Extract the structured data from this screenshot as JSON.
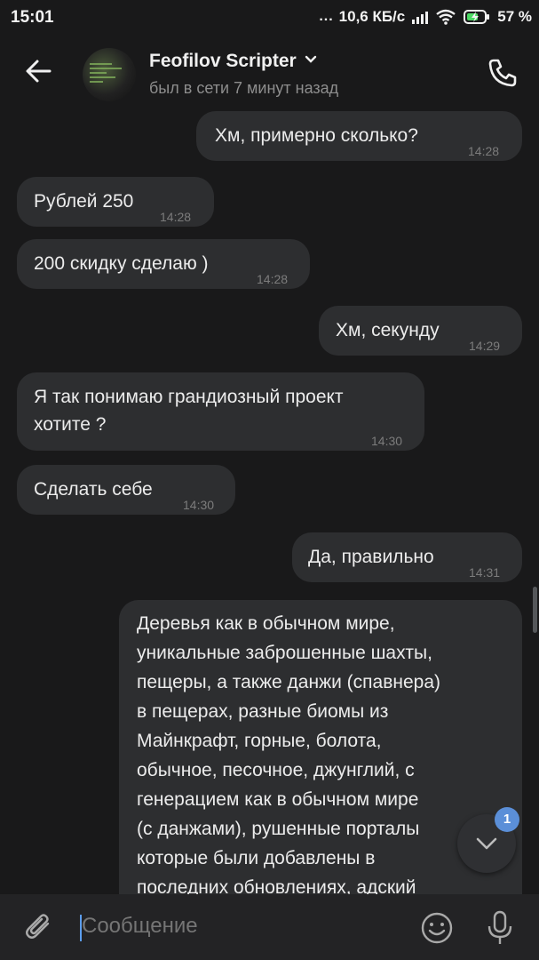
{
  "statusbar": {
    "time": "15:01",
    "dots": "...",
    "speed": "10,6 КБ/с",
    "battery": "57 %"
  },
  "header": {
    "contact_name": "Feofilov Scripter",
    "status": "был в сети 7 минут назад",
    "back_icon": "arrow-left-icon",
    "call_icon": "phone-icon",
    "dropdown_icon": "chevron-down-icon"
  },
  "messages": [
    {
      "direction": "out",
      "text": "Хм, примерно сколько?",
      "time": "14:28"
    },
    {
      "direction": "in",
      "text": "Рублей 250",
      "time": "14:28"
    },
    {
      "direction": "in",
      "text": "200 скидку сделаю )",
      "time": "14:28"
    },
    {
      "direction": "out",
      "text": "Хм, секунду",
      "time": "14:29"
    },
    {
      "direction": "in",
      "lines": [
        "Я так понимаю грандиозный проект",
        "хотите ?"
      ],
      "time": "14:30"
    },
    {
      "direction": "in",
      "text": "Сделать себе",
      "time": "14:30"
    },
    {
      "direction": "out",
      "text": "Да, правильно",
      "time": "14:31"
    },
    {
      "direction": "out",
      "lines": [
        "Деревья как в обычном мире,",
        "уникальные заброшенные шахты,",
        "пещеры, а также данжи (спавнера)",
        "в пещерах, разные биомы из",
        "Майнкрафт, горные, болота,",
        "обычное, песочное, джунглий, с",
        "генерацием как в обычном мире",
        "(с данжами), рушенные порталы",
        "которые были добавлены в",
        "последних обновлениях, адский"
      ]
    }
  ],
  "scroll_down": {
    "badge": "1",
    "icon": "chevron-down-icon"
  },
  "composer": {
    "placeholder": "Сообщение",
    "attach_icon": "paperclip-icon",
    "emoji_icon": "smiley-icon",
    "mic_icon": "microphone-icon"
  },
  "colors": {
    "background": "#19191a",
    "bubble": "#2d2e30",
    "accent": "#5b8fd8",
    "muted": "#8d8d8d"
  }
}
